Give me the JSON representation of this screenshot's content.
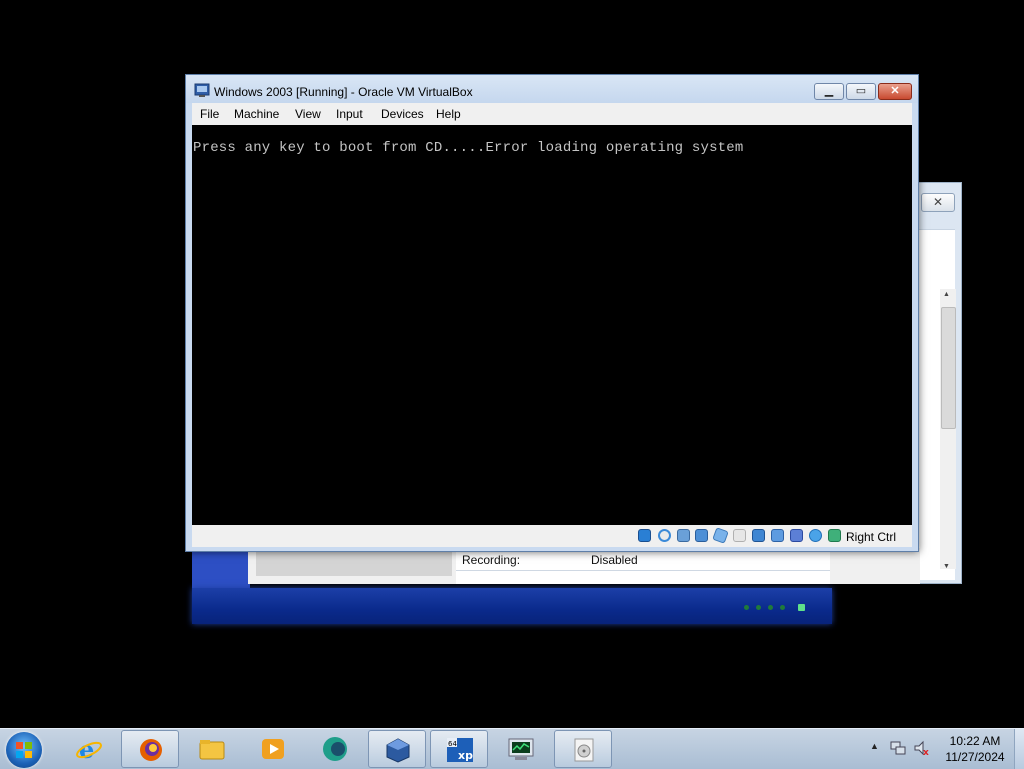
{
  "vm_window": {
    "title": "Windows 2003 [Running] - Oracle VM VirtualBox",
    "menu": [
      "File",
      "Machine",
      "View",
      "Input",
      "Devices",
      "Help"
    ],
    "console_text": "Press any key to boot from CD.....Error loading operating system",
    "host_key": "Right Ctrl",
    "status_icons": [
      "hard-disk-icon",
      "optical-drive-icon",
      "audio-icon",
      "network-icon",
      "usb-icon",
      "shared-folders-icon",
      "display-icon",
      "video-capture-icon",
      "cpu-icon",
      "mouse-integration-icon",
      "keyboard-icon"
    ]
  },
  "manager_details": {
    "recording_label": "Recording:",
    "recording_value": "Disabled"
  },
  "taskbar": {
    "time": "10:22 AM",
    "date": "11/27/2024",
    "items": [
      "internet-explorer",
      "firefox",
      "file-explorer",
      "media-player",
      "app-teal",
      "virtualbox",
      "windows-xp-64",
      "task-manager",
      "cd-drive"
    ]
  },
  "colors": {
    "console_text": "#c4c4c4",
    "title_bar": "#c9daf0",
    "xp_blue": "#0a2a8c",
    "taskbar": "#b9cbe0"
  }
}
